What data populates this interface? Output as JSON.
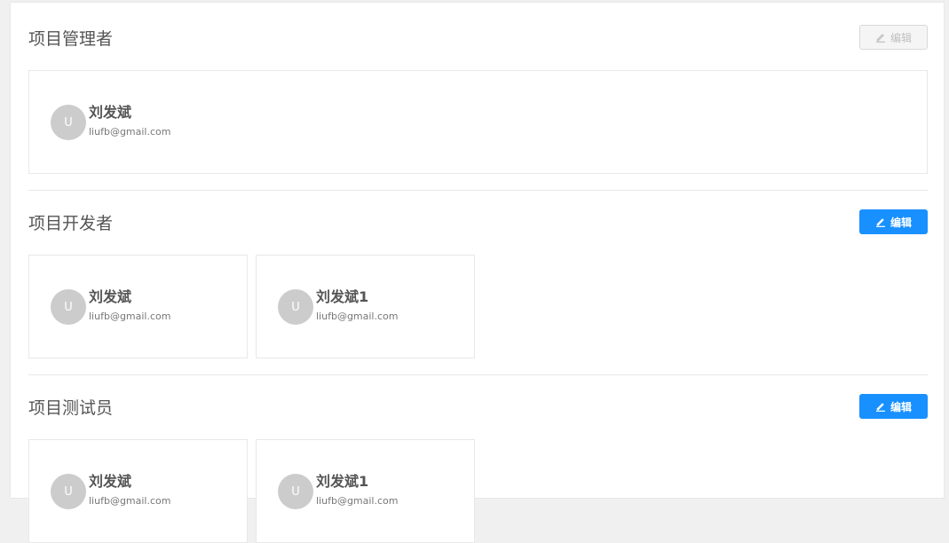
{
  "sections": [
    {
      "title": "项目管理者",
      "edit_label": "编辑",
      "edit_disabled": true,
      "members": [
        {
          "avatar": "U",
          "name": "刘发斌",
          "email": "liufb@gmail.com"
        }
      ]
    },
    {
      "title": "项目开发者",
      "edit_label": "编辑",
      "edit_disabled": false,
      "members": [
        {
          "avatar": "U",
          "name": "刘发斌",
          "email": "liufb@gmail.com"
        },
        {
          "avatar": "U",
          "name": "刘发斌1",
          "email": "liufb@gmail.com"
        }
      ]
    },
    {
      "title": "项目测试员",
      "edit_label": "编辑",
      "edit_disabled": false,
      "members": [
        {
          "avatar": "U",
          "name": "刘发斌",
          "email": "liufb@gmail.com"
        },
        {
          "avatar": "U",
          "name": "刘发斌1",
          "email": "liufb@gmail.com"
        }
      ]
    }
  ],
  "colors": {
    "primary": "#1890ff",
    "avatar_bg": "#cccccc",
    "disabled_text": "#bfbfbf"
  },
  "icons": {
    "edit": "edit-pencil-icon"
  }
}
